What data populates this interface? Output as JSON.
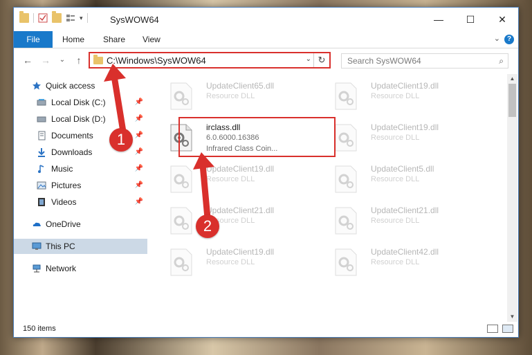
{
  "window": {
    "title": "SysWOW64",
    "controls": {
      "minimize": "—",
      "maximize": "☐",
      "close": "✕"
    }
  },
  "ribbon": {
    "tabs": [
      "File",
      "Home",
      "Share",
      "View"
    ],
    "expand_symbol": "⌄",
    "help_symbol": "?"
  },
  "navigation": {
    "back": "←",
    "forward": "→",
    "recent": "⌄",
    "up": "↑",
    "address": "C:\\Windows\\SysWOW64",
    "dropdown": "⌄",
    "refresh": "↻",
    "search_placeholder": "Search SysWOW64",
    "search_icon": "⌕"
  },
  "nav_pane": {
    "items": [
      {
        "label": "Quick access",
        "icon": "star-icon",
        "pinned": false
      },
      {
        "label": "Local Disk (C:)",
        "icon": "drive-icon",
        "pinned": true
      },
      {
        "label": "Local Disk (D:)",
        "icon": "drive-icon",
        "pinned": true
      },
      {
        "label": "Documents",
        "icon": "documents-icon",
        "pinned": true
      },
      {
        "label": "Downloads",
        "icon": "downloads-icon",
        "pinned": true
      },
      {
        "label": "Music",
        "icon": "music-icon",
        "pinned": true
      },
      {
        "label": "Pictures",
        "icon": "pictures-icon",
        "pinned": true
      },
      {
        "label": "Videos",
        "icon": "videos-icon",
        "pinned": true
      },
      {
        "label": "OneDrive",
        "icon": "onedrive-icon",
        "pinned": false
      },
      {
        "label": "This PC",
        "icon": "computer-icon",
        "pinned": false,
        "selected": true
      },
      {
        "label": "Network",
        "icon": "network-icon",
        "pinned": false
      }
    ],
    "pin_symbol": "📌"
  },
  "files": {
    "left_column": [
      {
        "name": "UpdateClient65.dll",
        "desc": "Resource DLL"
      },
      {
        "name": "irclass.dll",
        "desc": "6.0.6000.16386",
        "desc2": "Infrared Class Coin...",
        "highlighted": true
      },
      {
        "name": "UpdateClient19.dll",
        "desc": "Resource DLL"
      },
      {
        "name": "UpdateClient21.dll",
        "desc": "Resource DLL"
      },
      {
        "name": "UpdateClient19.dll",
        "desc": "Resource DLL"
      }
    ],
    "right_column": [
      {
        "name": "UpdateClient19.dll",
        "desc": "Resource DLL"
      },
      {
        "name": "UpdateClient19.dll",
        "desc": "Resource DLL"
      },
      {
        "name": "UpdateClient5.dll",
        "desc": "Resource DLL"
      },
      {
        "name": "UpdateClient21.dll",
        "desc": "Resource DLL"
      },
      {
        "name": "UpdateClient42.dll",
        "desc": "Resource DLL"
      }
    ]
  },
  "status": {
    "item_count": "150 items"
  },
  "annotations": {
    "step1": "1",
    "step2": "2"
  },
  "colors": {
    "accent": "#1979ca",
    "highlight": "#d9302c",
    "selected": "#ccd9e6"
  }
}
